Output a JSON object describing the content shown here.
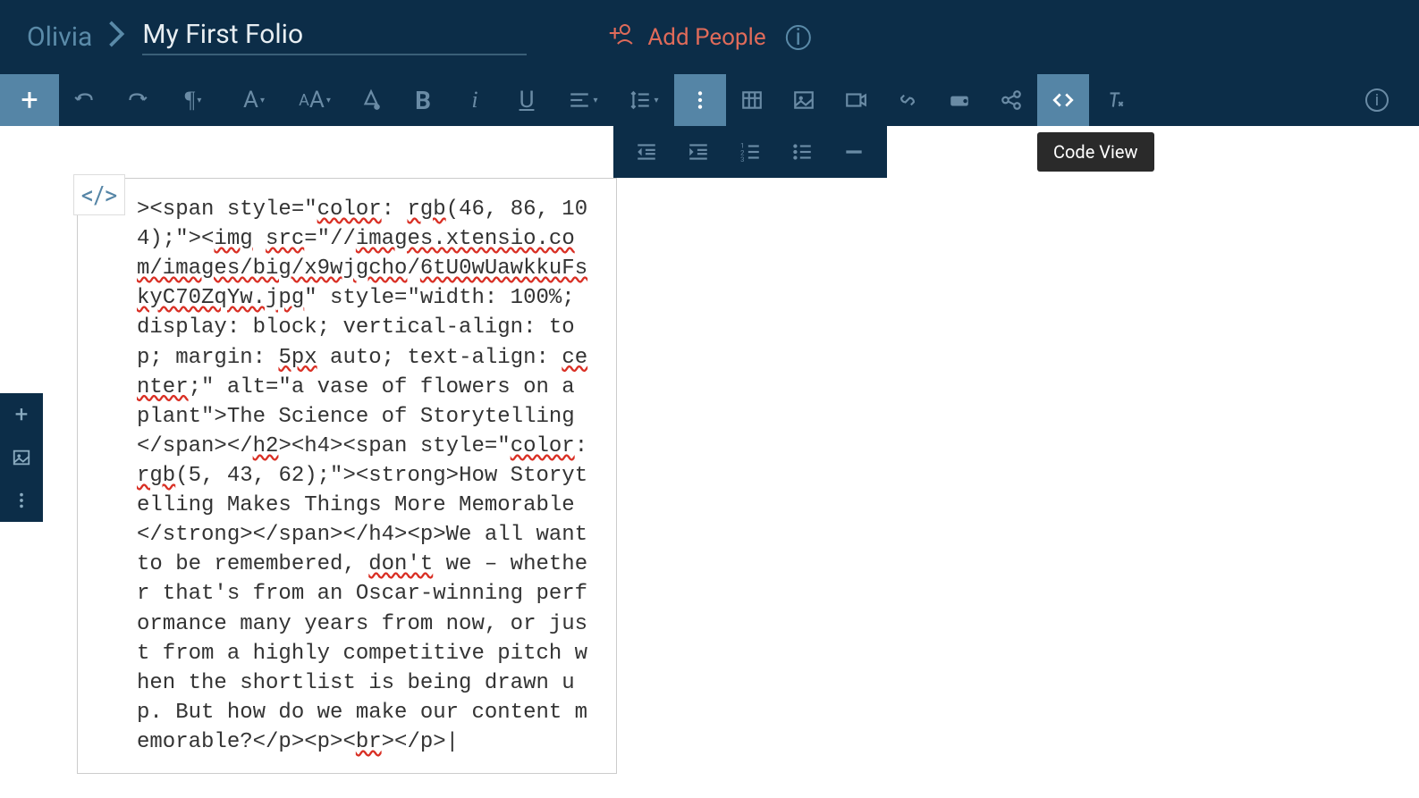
{
  "header": {
    "user": "Olivia",
    "title": "My First Folio",
    "add_people": "Add People"
  },
  "tooltip": "Code View",
  "code_editor": {
    "content_prefix": "><span style=\"",
    "w_color1": "color",
    "content_2": ": ",
    "w_rgb1": "rgb",
    "content_3": "(46, 86, 104);\"><",
    "w_img": "img",
    "content_4": " ",
    "w_src": "src",
    "content_5": "=\"//",
    "w_url": "images.xtensio.com/images/big/x9wjgcho",
    "content_6": "/",
    "w_file": "6tU0wUawkkuFskyC70ZqYw.jpg",
    "content_7": "\" style=\"width: 100%; display: block; vertical-align: top; margin: ",
    "w_5px": "5px",
    "content_8": " auto; text-align: ",
    "w_center": "center",
    "content_9": ";\" alt=\"a vase of flowers on a plant\">The Science of Storytelling</span></",
    "w_h2": "h2",
    "content_10": "><h4><span style=\"",
    "w_color2": "color",
    "content_11": ": ",
    "w_rgb2": "rgb",
    "content_12": "(5, 43, 62);\"><strong>How Storytelling Makes Things More Memorable</strong></span></h4><p>We all want to be remembered, ",
    "w_dont": "don't",
    "content_13": " we – whether that's from an Oscar-winning performance many years from now, or just from a highly competitive pitch when the shortlist is being drawn up. But how do we make our content memorable?</p><p><",
    "w_br": "br",
    "content_14": "></p>"
  }
}
